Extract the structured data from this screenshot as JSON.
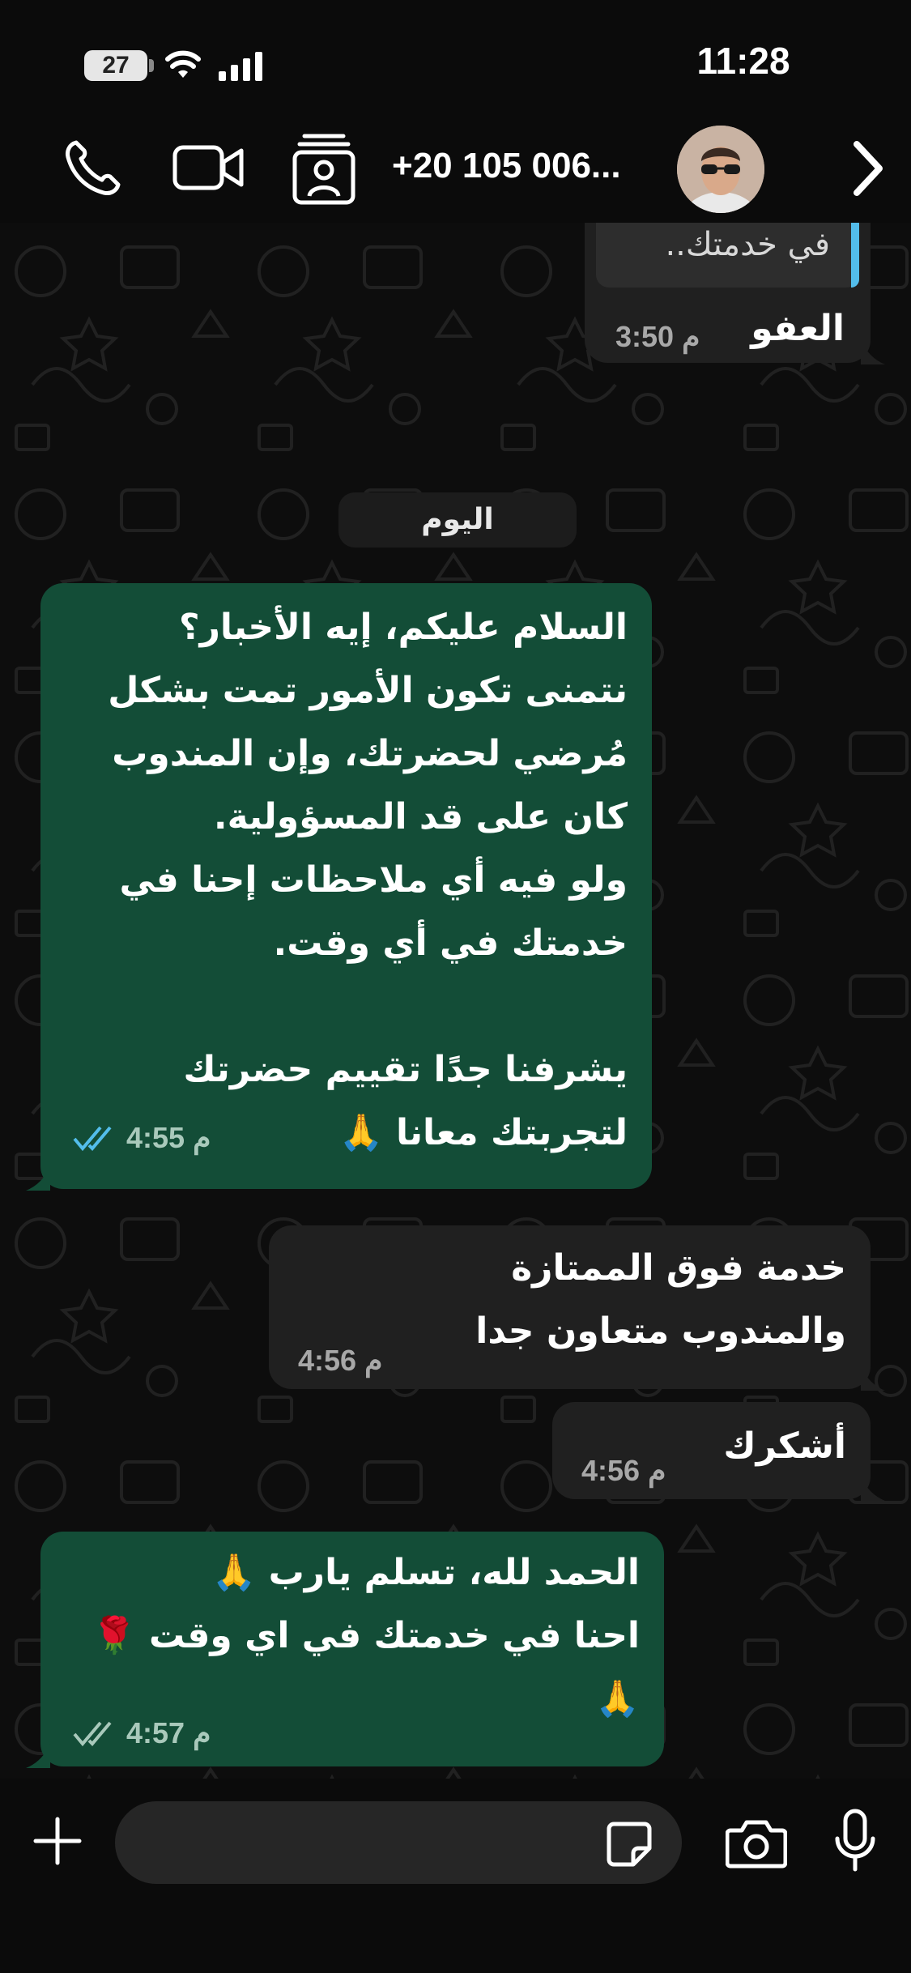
{
  "status_bar": {
    "time": "11:28",
    "battery": "27",
    "icons": [
      "battery-icon",
      "wifi-icon",
      "cellular-signal-icon"
    ]
  },
  "header": {
    "contact_name": "+20 105 006...",
    "icons": [
      "phone-icon",
      "video-camera-icon",
      "contact-card-icon",
      "chevron-right-icon"
    ]
  },
  "messages": {
    "quoted_reply": "في خدمتك..",
    "afwan": {
      "text": "العفو",
      "time": "3:50 م"
    },
    "date_separator": "اليوم",
    "greeting": {
      "text": "السلام عليكم، إيه الأخبار؟\nنتمنى تكون الأمور تمت بشكل\nمُرضي لحضرتك، وإن المندوب\nكان على قد المسؤولية.\nولو فيه أي ملاحظات إحنا في\nخدمتك في أي وقت.\n\nيشرفنا جدًا تقييم حضرتك\nلتجربتك معانا 🙏",
      "time": "4:55 م"
    },
    "service_reply": {
      "text": "خدمة فوق الممتازة\nوالمندوب متعاون جدا",
      "time": "4:56 م"
    },
    "thanks": {
      "text": "أشكرك",
      "time": "4:56 م"
    },
    "closing": {
      "text": "الحمد لله، تسلم يارب 🙏\nاحنا في خدمتك في اي وقت 🌹\n🙏",
      "time": "4:57 م"
    }
  },
  "composer": {
    "placeholder": "",
    "icons": [
      "plus-icon",
      "sticker-icon",
      "camera-icon",
      "microphone-icon"
    ]
  },
  "colors": {
    "outgoing_bubble": "#134d37",
    "incoming_bubble": "#202020",
    "read_receipt": "#53bdeb"
  }
}
